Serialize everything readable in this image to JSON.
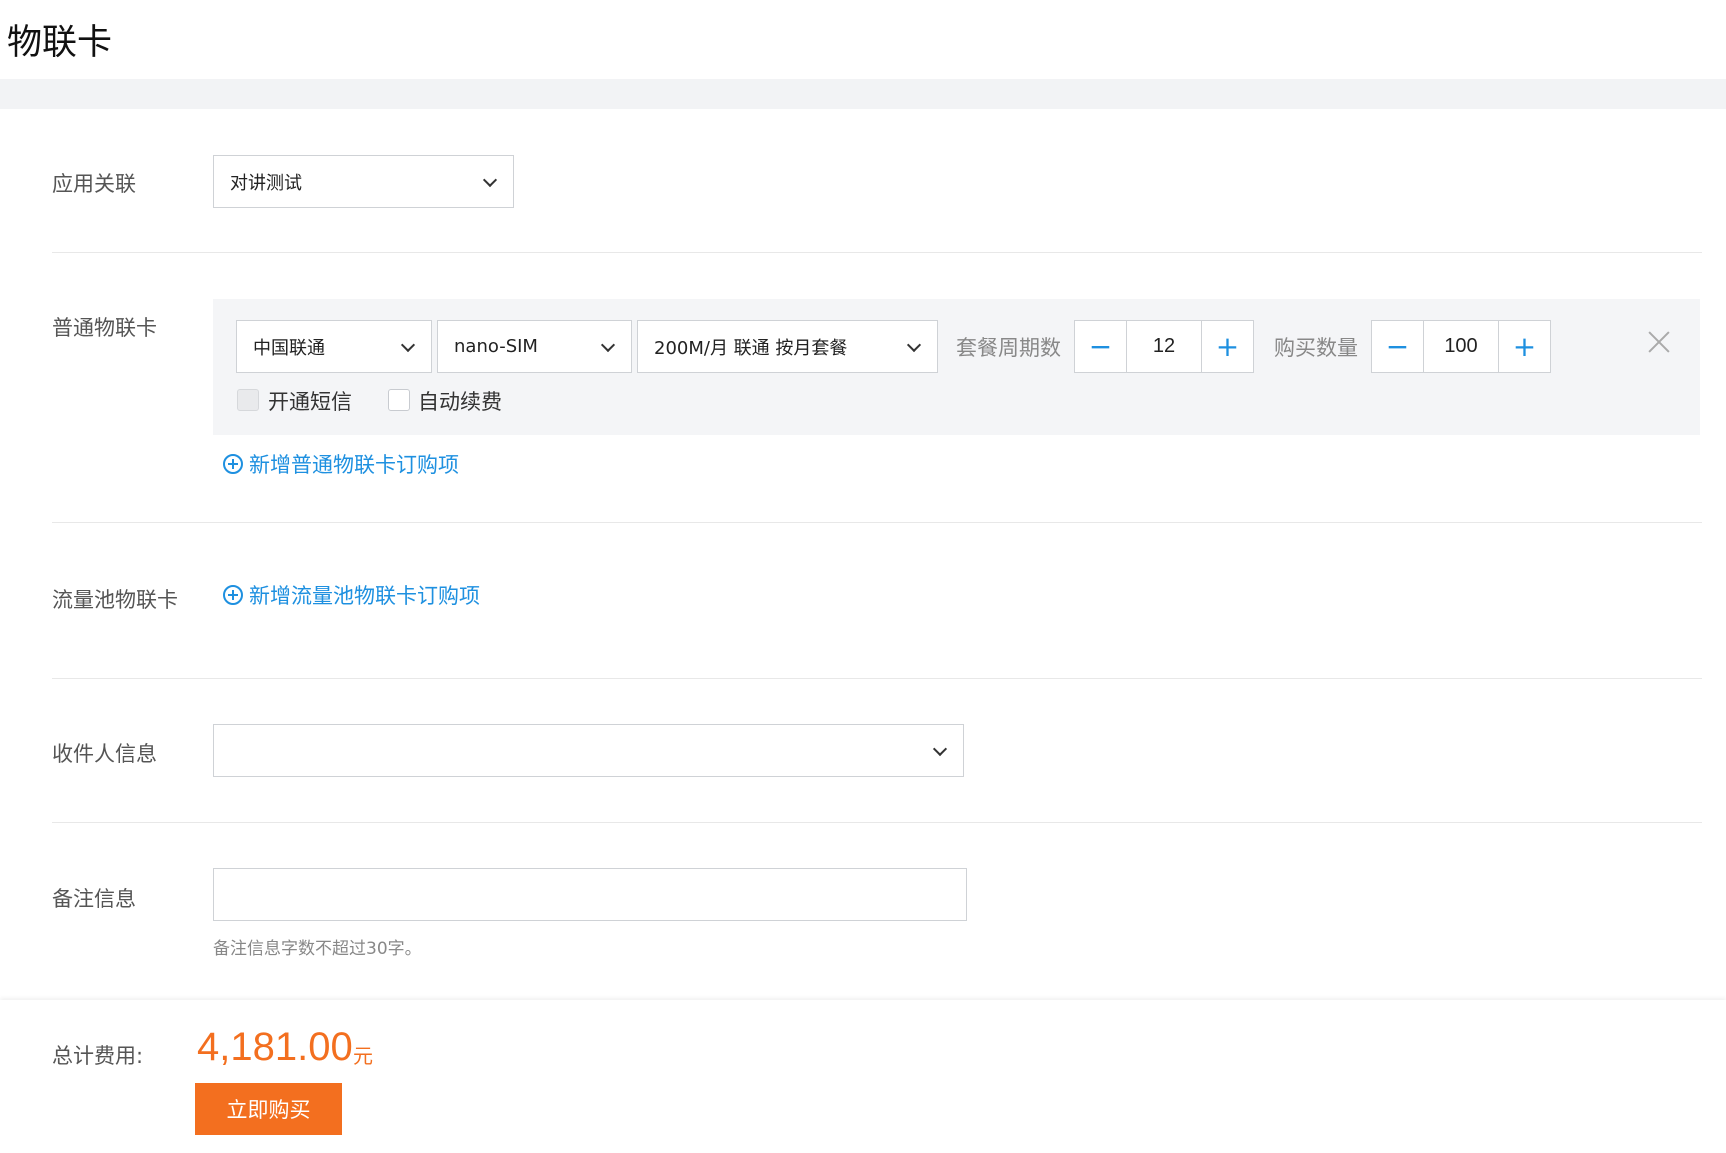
{
  "header": {
    "title": "物联卡"
  },
  "app_link": {
    "label": "应用关联",
    "selected": "对讲测试"
  },
  "normal_card": {
    "label": "普通物联卡",
    "operator": "中国联通",
    "sim_type": "nano-SIM",
    "plan": "200M/月 联通 按月套餐",
    "period_label": "套餐周期数",
    "period_value": "12",
    "quantity_label": "购买数量",
    "quantity_value": "100",
    "sms_label": "开通短信",
    "auto_renew_label": "自动续费",
    "add_link": "新增普通物联卡订购项"
  },
  "pool_card": {
    "label": "流量池物联卡",
    "add_link": "新增流量池物联卡订购项"
  },
  "recipient": {
    "label": "收件人信息",
    "selected": ""
  },
  "remark": {
    "label": "备注信息",
    "value": "",
    "hint": "备注信息字数不超过30字。"
  },
  "footer": {
    "total_label": "总计费用:",
    "total_amount": "4,181.00",
    "unit": "元",
    "buy_label": "立即购买"
  },
  "colors": {
    "accent": "#1e90e0",
    "price": "#f36f1f",
    "button": "#f36f1f"
  }
}
